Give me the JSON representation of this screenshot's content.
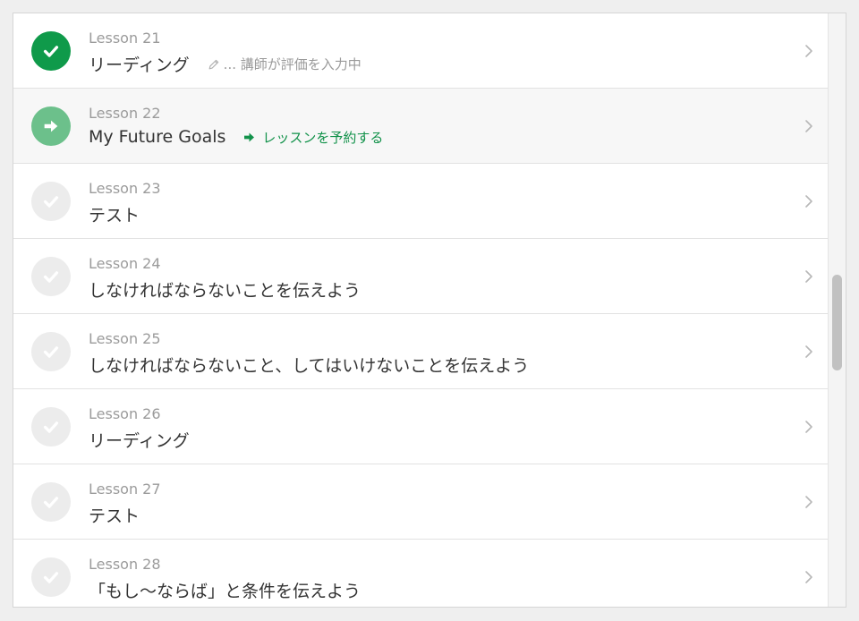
{
  "lessons": [
    {
      "number": "Lesson 21",
      "title": "リーディング",
      "status": "done",
      "note": "... 講師が評価を入力中",
      "note_icon": "pencil-icon"
    },
    {
      "number": "Lesson 22",
      "title": "My Future Goals",
      "status": "next",
      "action": "レッスンを予約する",
      "action_icon": "arrow-right-icon"
    },
    {
      "number": "Lesson 23",
      "title": "テスト",
      "status": "locked"
    },
    {
      "number": "Lesson 24",
      "title": "しなければならないことを伝えよう",
      "status": "locked"
    },
    {
      "number": "Lesson 25",
      "title": "しなければならないこと、してはいけないことを伝えよう",
      "status": "locked"
    },
    {
      "number": "Lesson 26",
      "title": "リーディング",
      "status": "locked"
    },
    {
      "number": "Lesson 27",
      "title": "テスト",
      "status": "locked"
    },
    {
      "number": "Lesson 28",
      "title": "「もし〜ならば」と条件を伝えよう",
      "status": "locked"
    }
  ],
  "colors": {
    "done": "#0f9a4a",
    "next": "#6cc08b",
    "locked": "#ececec",
    "action_text": "#12924a",
    "note_text": "#9a9a9a"
  }
}
